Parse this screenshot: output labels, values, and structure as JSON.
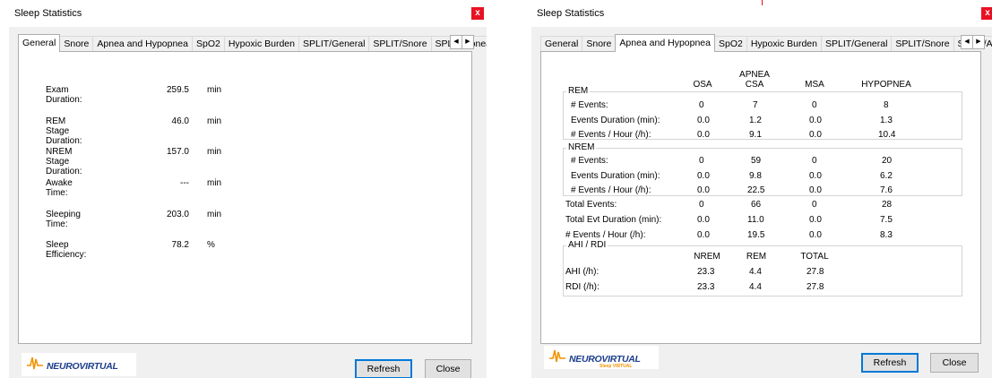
{
  "colors": {
    "close_bg": "#e81123",
    "brand_blue": "#1d3f8c",
    "brand_orange": "#f39200"
  },
  "left_window": {
    "title": "Sleep Statistics",
    "close": "x",
    "tabs": [
      "General",
      "Snore",
      "Apnea and Hypopnea",
      "SpO2",
      "Hypoxic Burden",
      "SPLIT/General",
      "SPLIT/Snore",
      "SPLIT/Apnea"
    ],
    "active_tab": "General",
    "rows": [
      {
        "label": "Exam Duration:",
        "value": "259.5",
        "unit": "min"
      },
      {
        "label": "REM Stage Duration:",
        "value": "46.0",
        "unit": "min"
      },
      {
        "label": "NREM Stage Duration:",
        "value": "157.0",
        "unit": "min"
      },
      {
        "label": "Awake Time:",
        "value": "---",
        "unit": "min"
      },
      {
        "label": "Sleeping Time:",
        "value": "203.0",
        "unit": "min"
      },
      {
        "label": "Sleep Efficiency:",
        "value": "78.2",
        "unit": "%"
      }
    ],
    "logo_text": "NEUROVIRTUAL",
    "refresh": "Refresh",
    "close_btn": "Close"
  },
  "right_window": {
    "title": "Sleep Statistics",
    "close": "x",
    "tabs": [
      "General",
      "Snore",
      "Apnea and Hypopnea",
      "SpO2",
      "Hypoxic Burden",
      "SPLIT/General",
      "SPLIT/Snore",
      "SPLIT/Apnea"
    ],
    "active_tab": "Apnea and Hypopnea",
    "apnea_header": "APNEA",
    "columns": [
      "OSA",
      "CSA",
      "MSA",
      "HYPOPNEA"
    ],
    "rem": {
      "label": "REM",
      "rows": [
        {
          "label": "# Events:",
          "values": [
            "0",
            "7",
            "0",
            "8"
          ]
        },
        {
          "label": "Events Duration (min):",
          "values": [
            "0.0",
            "1.2",
            "0.0",
            "1.3"
          ]
        },
        {
          "label": "# Events / Hour (/h):",
          "values": [
            "0.0",
            "9.1",
            "0.0",
            "10.4"
          ]
        }
      ]
    },
    "nrem": {
      "label": "NREM",
      "rows": [
        {
          "label": "# Events:",
          "values": [
            "0",
            "59",
            "0",
            "20"
          ]
        },
        {
          "label": "Events Duration (min):",
          "values": [
            "0.0",
            "9.8",
            "0.0",
            "6.2"
          ]
        },
        {
          "label": "# Events / Hour (/h):",
          "values": [
            "0.0",
            "22.5",
            "0.0",
            "7.6"
          ]
        }
      ]
    },
    "totals": [
      {
        "label": "Total Events:",
        "values": [
          "0",
          "66",
          "0",
          "28"
        ]
      },
      {
        "label": "Total Evt Duration (min):",
        "values": [
          "0.0",
          "11.0",
          "0.0",
          "7.5"
        ]
      },
      {
        "label": "# Events / Hour (/h):",
        "values": [
          "0.0",
          "19.5",
          "0.0",
          "8.3"
        ]
      }
    ],
    "ahi": {
      "label": "AHI / RDI",
      "columns": [
        "NREM",
        "REM",
        "TOTAL"
      ],
      "rows": [
        {
          "label": "AHI (/h):",
          "values": [
            "23.3",
            "4.4",
            "27.8"
          ]
        },
        {
          "label": "RDI (/h):",
          "values": [
            "23.3",
            "4.4",
            "27.8"
          ]
        }
      ]
    },
    "logo_text": "NEUROVIRTUAL",
    "logo_sub": "Sleep VIRTUAL",
    "refresh": "Refresh",
    "close_btn": "Close"
  }
}
